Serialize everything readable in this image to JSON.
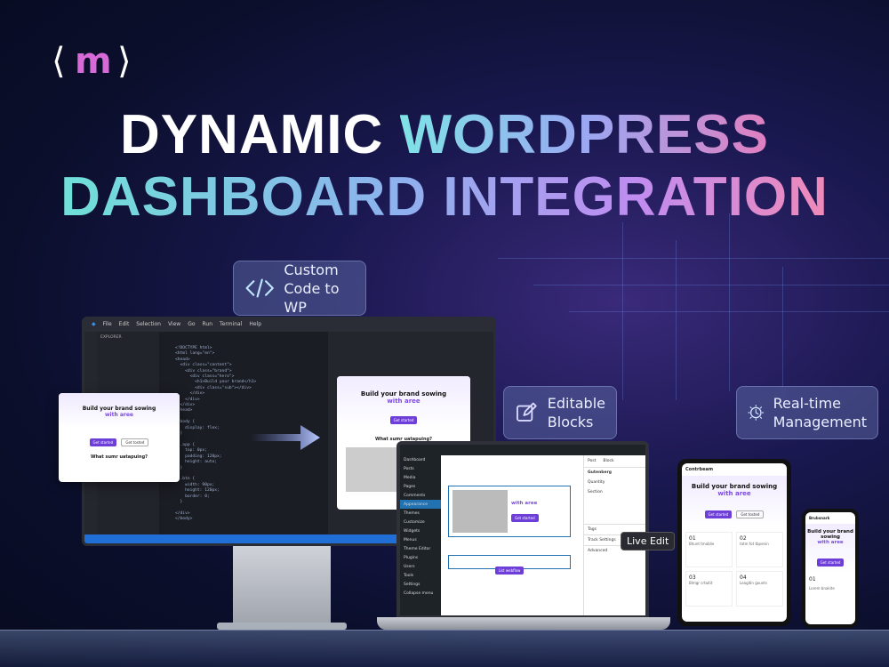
{
  "brand": {
    "logo_left": "⟨",
    "logo_mid": "m",
    "logo_right": "⟩"
  },
  "headline": {
    "line1_white": "DYNAMIC",
    "line1_gradient": "WORDPRESS",
    "line2_gradient": "DASHBOARD INTEGRATION"
  },
  "badges": {
    "custom_code": "Custom\nCode to WP",
    "editable_blocks": "Editable\nBlocks",
    "realtime": "Real-time\nManagement"
  },
  "live_edit_label": "Live Edit",
  "icons": {
    "code": "code-brackets-icon",
    "edit": "edit-pencil-icon",
    "clock": "clock-icon",
    "arrow": "arrow-right-icon"
  },
  "vscode": {
    "menu": [
      "File",
      "Edit",
      "Selection",
      "View",
      "Go",
      "Run",
      "Terminal",
      "Help"
    ],
    "explorer_title": "EXPLORER",
    "code_lines": "<!DOCTYPE html>\n<html lang=\"en\">\n<head>\n  <div class=\"content\">\n    <div class=\"brand\">\n      <div class=\"hero\">\n        <h1>Build your brand</h1>\n        <div class=\"sub\"></div>\n      </div>\n    </div>\n  </div>\n</head>\n\n  body {\n    display: flex;\n  }\n\n  .app {\n    top: 0px;\n    padding: 120px;\n    height: auto;\n  }\n\n  .btn {\n    width: 90px;\n    height: 120px;\n    border: 0;\n  }\n\n</div>\n</body>"
  },
  "site": {
    "hero_line1": "Build your brand sowing",
    "hero_line2_plain": "with ",
    "hero_line2_accent": "with aree",
    "cta_primary": "Get started",
    "cta_secondary": "Get tosted",
    "section_title": "What sumr uatapuing?",
    "list_button": "List webflow"
  },
  "wp": {
    "menu": [
      "Dashboard",
      "Posts",
      "Media",
      "Pages",
      "Comments",
      "Appearance",
      "Themes",
      "Customize",
      "Widgets",
      "Menus",
      "Theme Editor",
      "Plugins",
      "Users",
      "Tools",
      "Settings",
      "Collapse menu"
    ],
    "panel_tabs": [
      "Post",
      "Block"
    ],
    "panel_items": [
      "Gutenberg",
      "Quantity",
      "Section",
      "Tags",
      "Track Settings",
      "Advanced"
    ]
  },
  "tablet": {
    "app_name": "Contrbeam",
    "hero_line1": "Build your brand sowing",
    "hero_accent": "with aree",
    "cards": [
      "01",
      "02",
      "03",
      "04"
    ],
    "card_titles": [
      "Bhunt tmablie",
      "tatm fot tbpenin",
      "Blmgr crtaitit",
      "Leagitin gounts"
    ]
  },
  "phone": {
    "app_name": "Brubsnark",
    "hero_line1": "Build your brand sowing",
    "hero_accent": "with aree",
    "card": "01",
    "card_title": "Lorem bnakite"
  }
}
